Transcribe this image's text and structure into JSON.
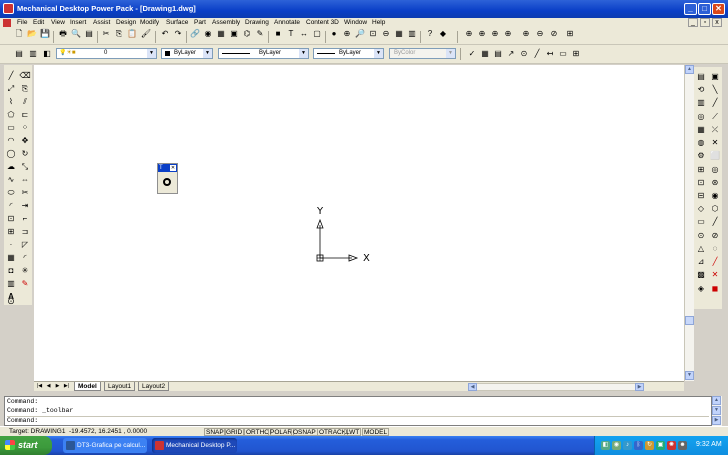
{
  "window": {
    "title": "Mechanical Desktop Power Pack - [Drawing1.dwg]",
    "minimize": "_",
    "maximize": "□",
    "close": "✕"
  },
  "menu": [
    "File",
    "Edit",
    "View",
    "Insert",
    "Assist",
    "Design",
    "Modify",
    "Surface",
    "Part",
    "Assembly",
    "Drawing",
    "Annotate",
    "Content 3D",
    "Window",
    "Help"
  ],
  "properties": {
    "layer": "0",
    "color": "ByLayer",
    "linetype": "ByLayer",
    "lineweight": "ByLayer",
    "plotstyle": "ByColor"
  },
  "floating_toolbar": {
    "title": "T"
  },
  "ucs": {
    "y_label": "Y",
    "x_label": "X"
  },
  "tabs": [
    {
      "label": "Model"
    },
    {
      "label": "Layout1"
    },
    {
      "label": "Layout2"
    }
  ],
  "command_lines": [
    "Command:",
    "Command: _toolbar",
    "Command:"
  ],
  "status": {
    "target": "Target: DRAWING1",
    "coords": "-19.4572, 16.2451 , 0.0000",
    "snap": "SNAP",
    "grid": "GRID",
    "ortho": "ORTHO",
    "polar": "POLAR",
    "osnap": "OSNAP",
    "otrack": "OTRACK",
    "lwt": "LWT",
    "model": "MODEL"
  },
  "taskbar": {
    "start": "start",
    "tasks": [
      "DT3-Grafica pe calcul...",
      "Mechanical Desktop P..."
    ],
    "clock": "9:32 AM"
  },
  "colors": {
    "titlebar": "#0a3fc7",
    "taskbar": "#245edb",
    "start": "#3c9a3c",
    "chrome": "#ece9d8"
  }
}
